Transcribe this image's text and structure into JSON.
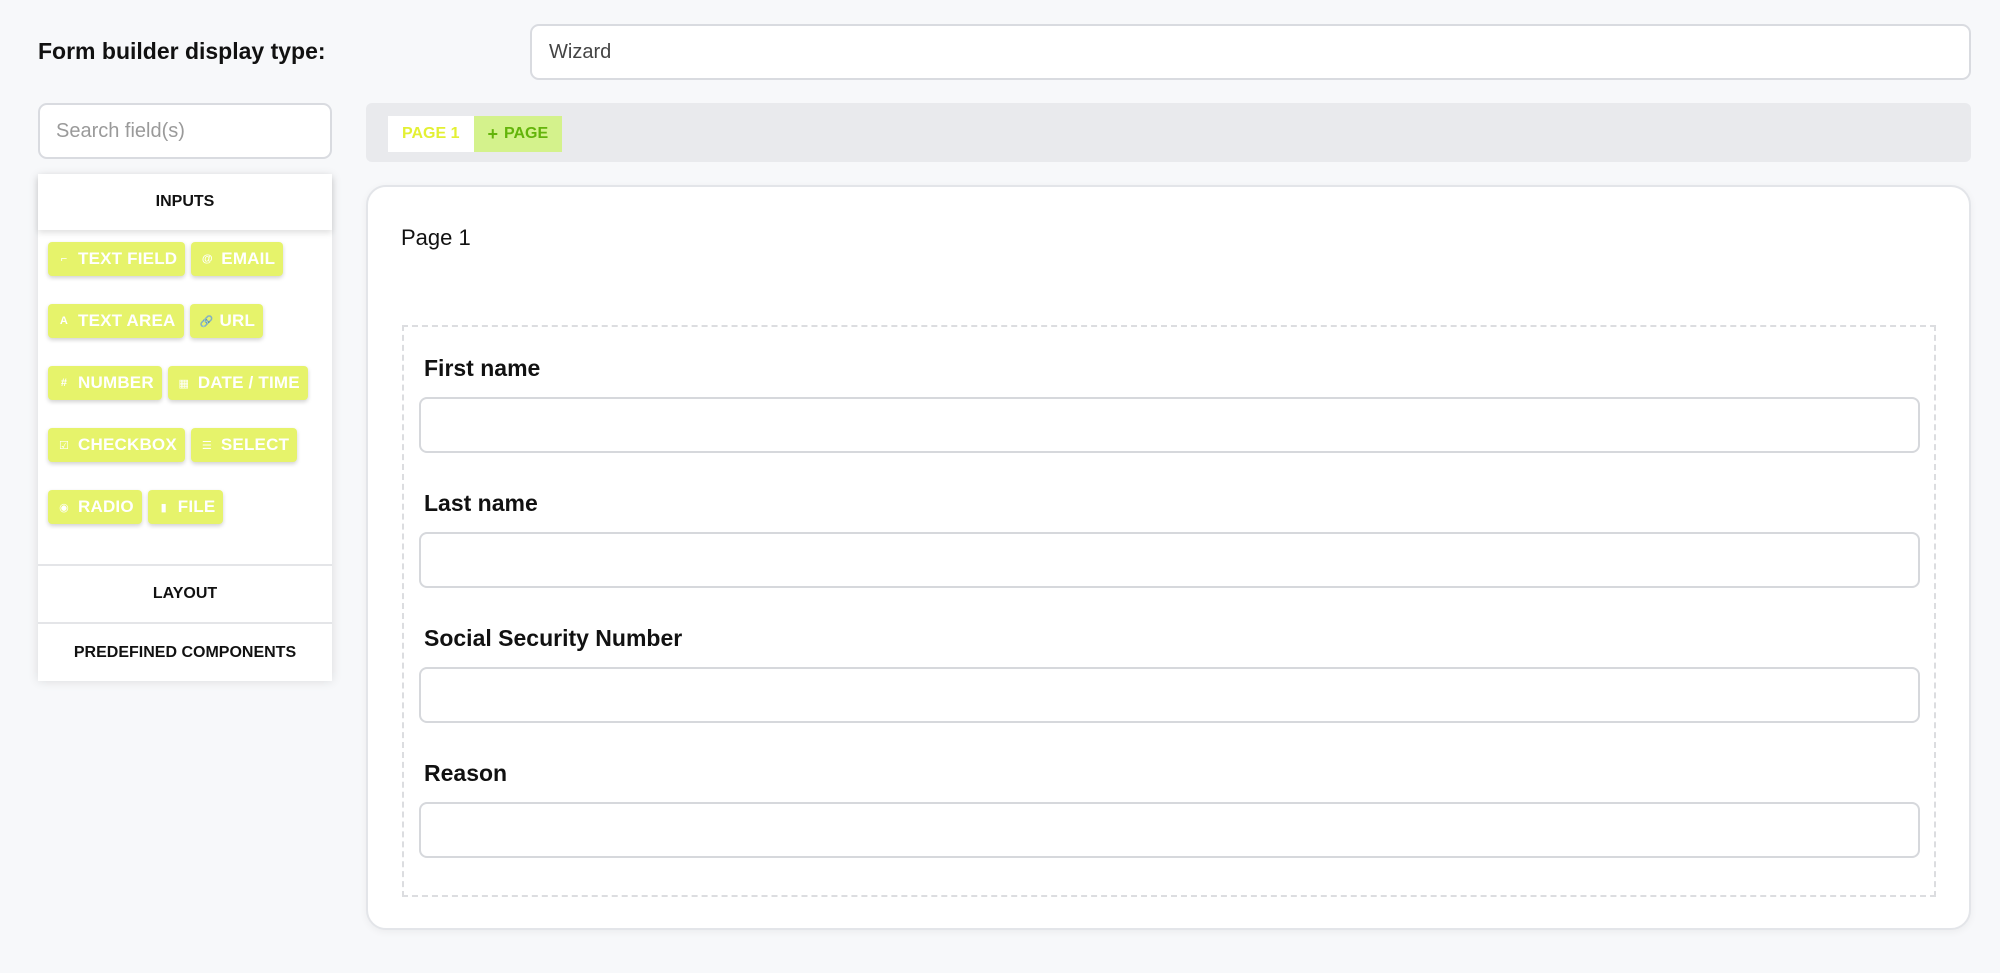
{
  "header": {
    "display_type_label": "Form builder display type:",
    "display_type_value": "Wizard"
  },
  "sidebar": {
    "search_placeholder": "Search field(s)",
    "sections": {
      "inputs": "INPUTS",
      "layout": "LAYOUT",
      "predefined": "PREDEFINED COMPONENTS"
    },
    "components": [
      {
        "label": "TEXT FIELD",
        "icon": "text-field-icon",
        "glyph": "⌐"
      },
      {
        "label": "EMAIL",
        "icon": "at-icon",
        "glyph": "@"
      },
      {
        "label": "TEXT AREA",
        "icon": "font-icon",
        "glyph": "A"
      },
      {
        "label": "URL",
        "icon": "link-icon",
        "glyph": "🔗"
      },
      {
        "label": "NUMBER",
        "icon": "hashtag-icon",
        "glyph": "#"
      },
      {
        "label": "DATE / TIME",
        "icon": "calendar-icon",
        "glyph": "▦"
      },
      {
        "label": "CHECKBOX",
        "icon": "check-square-icon",
        "glyph": "☑"
      },
      {
        "label": "SELECT",
        "icon": "list-icon",
        "glyph": "☰"
      },
      {
        "label": "RADIO",
        "icon": "dot-circle-icon",
        "glyph": "◉"
      },
      {
        "label": "FILE",
        "icon": "file-icon",
        "glyph": "▮"
      }
    ]
  },
  "tabs": {
    "page1": "PAGE 1",
    "add_page": "PAGE",
    "add_icon": "plus-icon"
  },
  "page": {
    "title": "Page 1",
    "fields": [
      {
        "label": "First name",
        "value": ""
      },
      {
        "label": "Last name",
        "value": ""
      },
      {
        "label": "Social Security Number",
        "value": ""
      },
      {
        "label": "Reason",
        "value": ""
      }
    ]
  },
  "colors": {
    "chip_bg": "#e6f36b",
    "tab_active_text": "#e3f033",
    "add_tab_bg": "#d4f28c",
    "add_tab_text": "#63b40a"
  }
}
